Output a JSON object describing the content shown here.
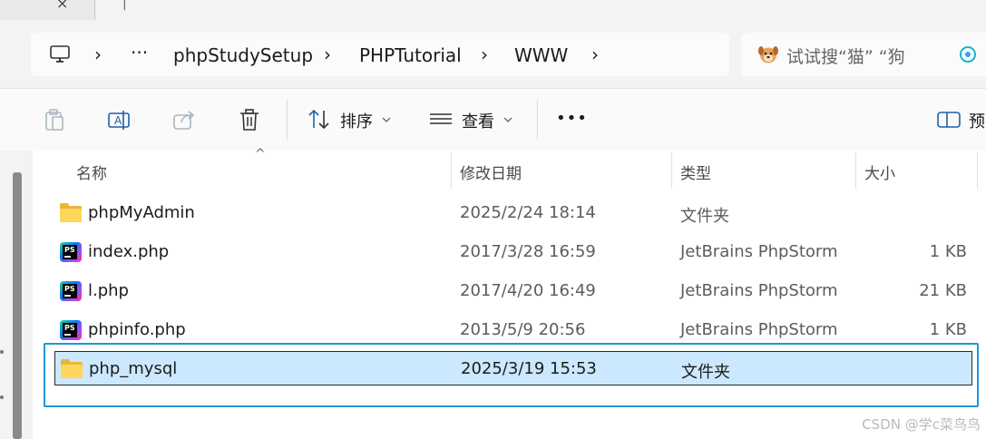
{
  "tab": {
    "close_glyph": "×",
    "sep_glyph": "|"
  },
  "breadcrumb": {
    "root_icon": "monitor-icon",
    "ellipsis": "···",
    "chevron": "›",
    "items": [
      "phpStudySetup",
      "PHPTutorial",
      "WWW"
    ]
  },
  "search": {
    "text": "试试搜“猫”  “狗"
  },
  "toolbar": {
    "sort_label": "排序",
    "view_label": "查看",
    "more_label": "•••",
    "preview_label": "预"
  },
  "columns": {
    "name": "名称",
    "modified": "修改日期",
    "type": "类型",
    "size": "大小",
    "sort_glyph": "^"
  },
  "files": [
    {
      "name": "phpMyAdmin",
      "date": "2025/2/24 18:14",
      "type": "文件夹",
      "size": "",
      "icon": "folder-icon"
    },
    {
      "name": "index.php",
      "date": "2017/3/28 16:59",
      "type": "JetBrains PhpStorm",
      "size": "1 KB",
      "icon": "phpstorm-file-icon"
    },
    {
      "name": "l.php",
      "date": "2017/4/20 16:49",
      "type": "JetBrains PhpStorm",
      "size": "21 KB",
      "icon": "phpstorm-file-icon"
    },
    {
      "name": "phpinfo.php",
      "date": "2013/5/9 20:56",
      "type": "JetBrains PhpStorm",
      "size": "1 KB",
      "icon": "phpstorm-file-icon"
    },
    {
      "name": "php_mysql",
      "date": "2025/3/19 15:53",
      "type": "文件夹",
      "size": "",
      "icon": "folder-icon",
      "selected": true
    }
  ],
  "watermark": "CSDN @学c菜鸟鸟",
  "colors": {
    "selection": "#cce8ff",
    "highlight_border": "#1a9ad6",
    "folder": "#ffd659"
  }
}
